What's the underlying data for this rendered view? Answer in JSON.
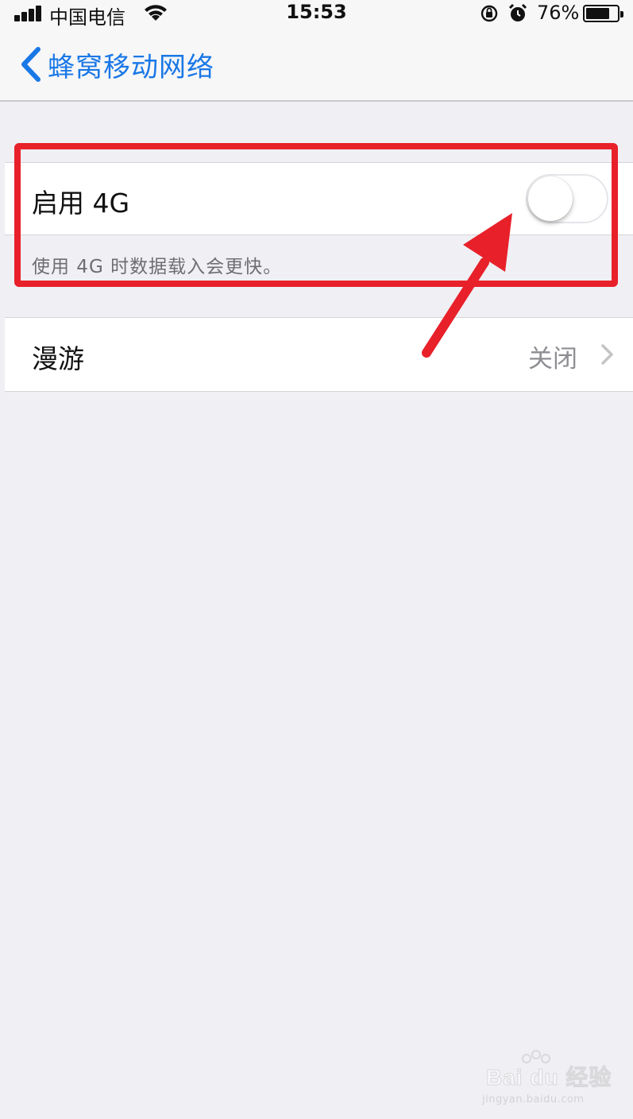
{
  "status_bar": {
    "carrier": "中国电信",
    "time": "15:53",
    "battery_percent": "76%",
    "battery_level": 0.76,
    "icons": [
      "signal-icon",
      "wifi-icon",
      "rotation-lock-icon",
      "alarm-icon",
      "battery-icon"
    ]
  },
  "nav": {
    "back_label": "蜂窝移动网络"
  },
  "group_4g": {
    "label": "启用 4G",
    "toggle_on": false,
    "footer": "使用 4G 时数据载入会更快。"
  },
  "group_roaming": {
    "label": "漫游",
    "value": "关闭"
  },
  "annotation": {
    "color": "#e8202a"
  },
  "watermark": {
    "brand": "Bai du 经验",
    "url": "jingyan.baidu.com"
  },
  "colors": {
    "accent": "#1a78e6",
    "background": "#efeff4",
    "secondary_text": "#8e8e93"
  }
}
